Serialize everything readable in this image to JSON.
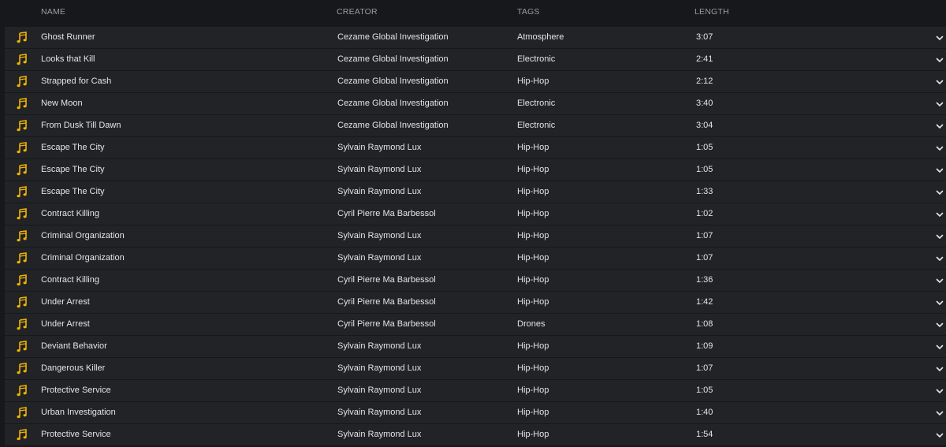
{
  "header": {
    "name": "NAME",
    "creator": "CREATOR",
    "tags": "TAGS",
    "length": "LENGTH"
  },
  "icons": {
    "row_icon": "music-note-icon",
    "row_expand": "chevron-down-icon"
  },
  "colors": {
    "accent": "#f0b400",
    "row_bg": "#222327",
    "page_bg": "#17181b"
  },
  "tracks": [
    {
      "name": "Ghost Runner",
      "creator": "Cezame Global Investigation",
      "tags": "Atmosphere",
      "length": "3:07"
    },
    {
      "name": "Looks that Kill",
      "creator": "Cezame Global Investigation",
      "tags": "Electronic",
      "length": "2:41"
    },
    {
      "name": "Strapped for Cash",
      "creator": "Cezame Global Investigation",
      "tags": "Hip-Hop",
      "length": "2:12"
    },
    {
      "name": "New Moon",
      "creator": "Cezame Global Investigation",
      "tags": "Electronic",
      "length": "3:40"
    },
    {
      "name": "From Dusk Till Dawn",
      "creator": "Cezame Global Investigation",
      "tags": "Electronic",
      "length": "3:04"
    },
    {
      "name": "Escape The City",
      "creator": "Sylvain Raymond Lux",
      "tags": "Hip-Hop",
      "length": "1:05"
    },
    {
      "name": "Escape The City",
      "creator": "Sylvain Raymond Lux",
      "tags": "Hip-Hop",
      "length": "1:05"
    },
    {
      "name": "Escape The City",
      "creator": "Sylvain Raymond Lux",
      "tags": "Hip-Hop",
      "length": "1:33"
    },
    {
      "name": "Contract Killing",
      "creator": "Cyril Pierre Ma Barbessol",
      "tags": "Hip-Hop",
      "length": "1:02"
    },
    {
      "name": "Criminal Organization",
      "creator": "Sylvain Raymond Lux",
      "tags": "Hip-Hop",
      "length": "1:07"
    },
    {
      "name": "Criminal Organization",
      "creator": "Sylvain Raymond Lux",
      "tags": "Hip-Hop",
      "length": "1:07"
    },
    {
      "name": "Contract Killing",
      "creator": "Cyril Pierre Ma Barbessol",
      "tags": "Hip-Hop",
      "length": "1:36"
    },
    {
      "name": "Under Arrest",
      "creator": "Cyril Pierre Ma Barbessol",
      "tags": "Hip-Hop",
      "length": "1:42"
    },
    {
      "name": "Under Arrest",
      "creator": "Cyril Pierre Ma Barbessol",
      "tags": "Drones",
      "length": "1:08"
    },
    {
      "name": "Deviant Behavior",
      "creator": "Sylvain Raymond Lux",
      "tags": "Hip-Hop",
      "length": "1:09"
    },
    {
      "name": "Dangerous Killer",
      "creator": "Sylvain Raymond Lux",
      "tags": "Hip-Hop",
      "length": "1:07"
    },
    {
      "name": "Protective Service",
      "creator": "Sylvain Raymond Lux",
      "tags": "Hip-Hop",
      "length": "1:05"
    },
    {
      "name": "Urban Investigation",
      "creator": "Sylvain Raymond Lux",
      "tags": "Hip-Hop",
      "length": "1:40"
    },
    {
      "name": "Protective Service",
      "creator": "Sylvain Raymond Lux",
      "tags": "Hip-Hop",
      "length": "1:54"
    }
  ]
}
